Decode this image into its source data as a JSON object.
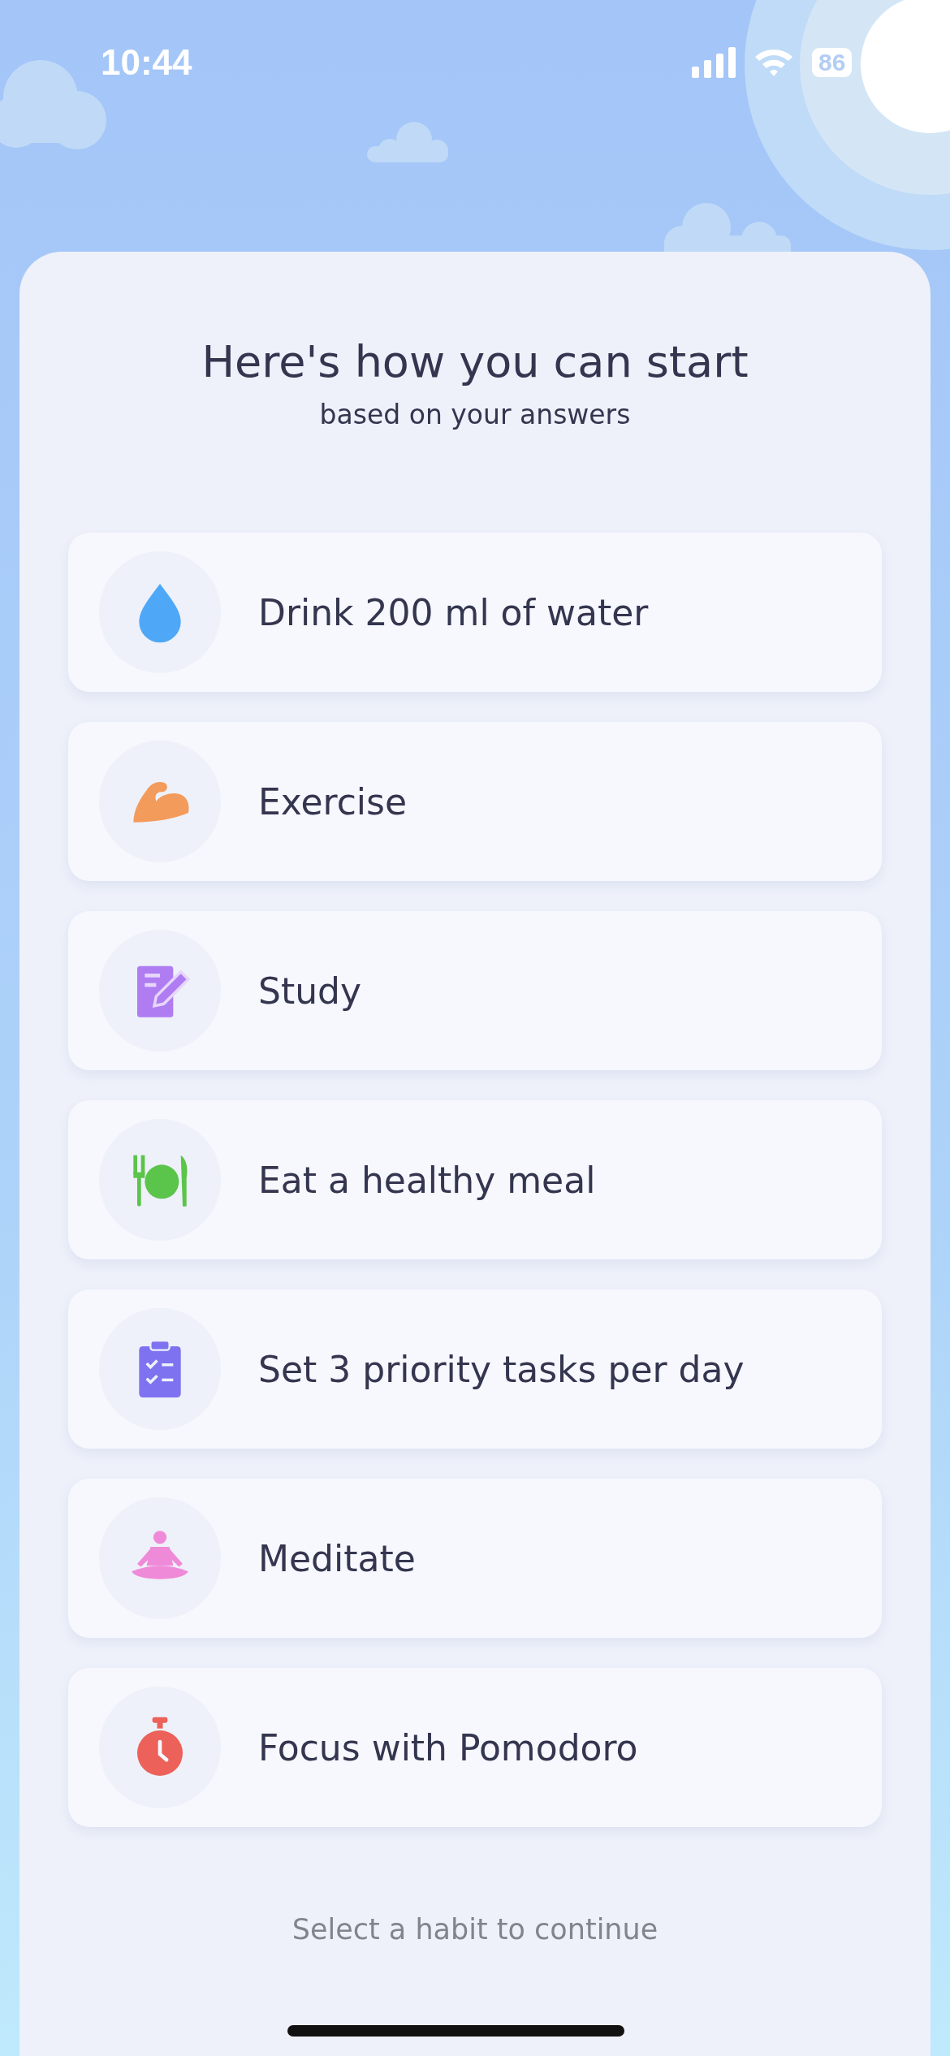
{
  "status_bar": {
    "time": "10:44",
    "battery": "86"
  },
  "title": "Here's how you can start",
  "subtitle": "based on your answers",
  "habits": [
    {
      "label": "Drink 200 ml of water",
      "kind": "water"
    },
    {
      "label": "Exercise",
      "kind": "muscle"
    },
    {
      "label": "Study",
      "kind": "notebook"
    },
    {
      "label": "Eat a healthy meal",
      "kind": "meal"
    },
    {
      "label": "Set 3 priority tasks per day",
      "kind": "tasks"
    },
    {
      "label": "Meditate",
      "kind": "meditate"
    },
    {
      "label": "Focus with Pomodoro",
      "kind": "timer"
    }
  ],
  "footer": "Select a habit to continue"
}
